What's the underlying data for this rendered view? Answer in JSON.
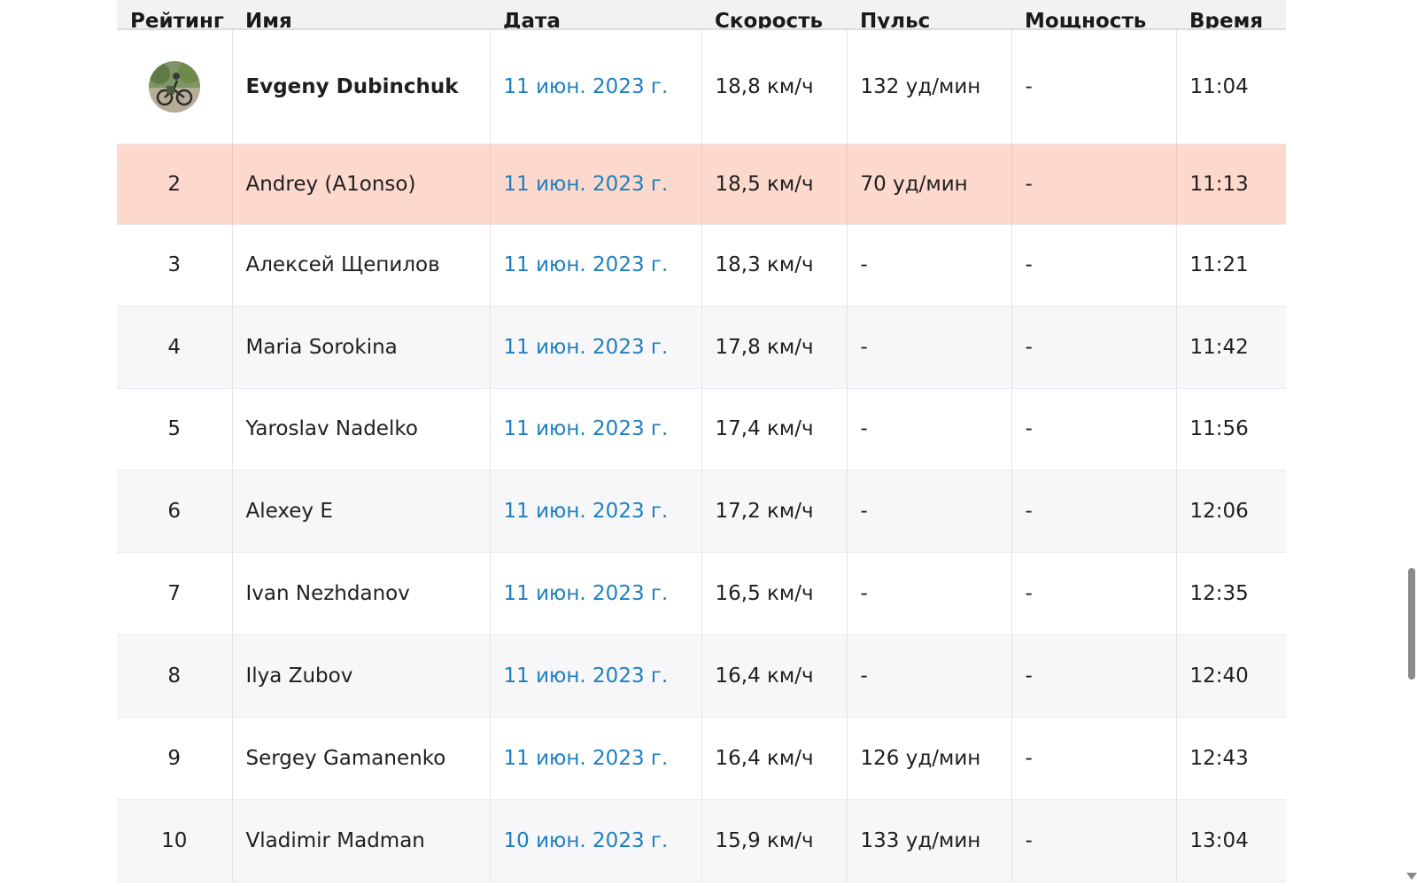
{
  "table": {
    "headers": [
      "Рейтинг",
      "Имя",
      "Дата",
      "Скорость",
      "Пульс",
      "Мощность",
      "Время"
    ],
    "rows": [
      {
        "rank": "",
        "name": "Evgeny Dubinchuk",
        "date": "11 июн. 2023 г.",
        "speed": "18,8 км/ч",
        "hr": "132 уд/мин",
        "power": "-",
        "time": "11:04"
      },
      {
        "rank": "2",
        "name": "Andrey (A1onso)",
        "date": "11 июн. 2023 г.",
        "speed": "18,5 км/ч",
        "hr": "70 уд/мин",
        "power": "-",
        "time": "11:13"
      },
      {
        "rank": "3",
        "name": "Алексей Щепилов",
        "date": "11 июн. 2023 г.",
        "speed": "18,3 км/ч",
        "hr": "-",
        "power": "-",
        "time": "11:21"
      },
      {
        "rank": "4",
        "name": "Maria Sorokina",
        "date": "11 июн. 2023 г.",
        "speed": "17,8 км/ч",
        "hr": "-",
        "power": "-",
        "time": "11:42"
      },
      {
        "rank": "5",
        "name": "Yaroslav Nadelko",
        "date": "11 июн. 2023 г.",
        "speed": "17,4 км/ч",
        "hr": "-",
        "power": "-",
        "time": "11:56"
      },
      {
        "rank": "6",
        "name": "Alexey E",
        "date": "11 июн. 2023 г.",
        "speed": "17,2 км/ч",
        "hr": "-",
        "power": "-",
        "time": "12:06"
      },
      {
        "rank": "7",
        "name": "Ivan Nezhdanov",
        "date": "11 июн. 2023 г.",
        "speed": "16,5 км/ч",
        "hr": "-",
        "power": "-",
        "time": "12:35"
      },
      {
        "rank": "8",
        "name": "Ilya Zubov",
        "date": "11 июн. 2023 г.",
        "speed": "16,4 км/ч",
        "hr": "-",
        "power": "-",
        "time": "12:40"
      },
      {
        "rank": "9",
        "name": "Sergey Gamanenko",
        "date": "11 июн. 2023 г.",
        "speed": "16,4 км/ч",
        "hr": "126 уд/мин",
        "power": "-",
        "time": "12:43"
      },
      {
        "rank": "10",
        "name": "Vladimir Madman",
        "date": "10 июн. 2023 г.",
        "speed": "15,9 км/ч",
        "hr": "133 уд/мин",
        "power": "-",
        "time": "13:04"
      }
    ],
    "first_row_icon": "avatar-photo-icon",
    "highlight_color": "#fdd8cc",
    "link_color": "#1d7fbf"
  }
}
